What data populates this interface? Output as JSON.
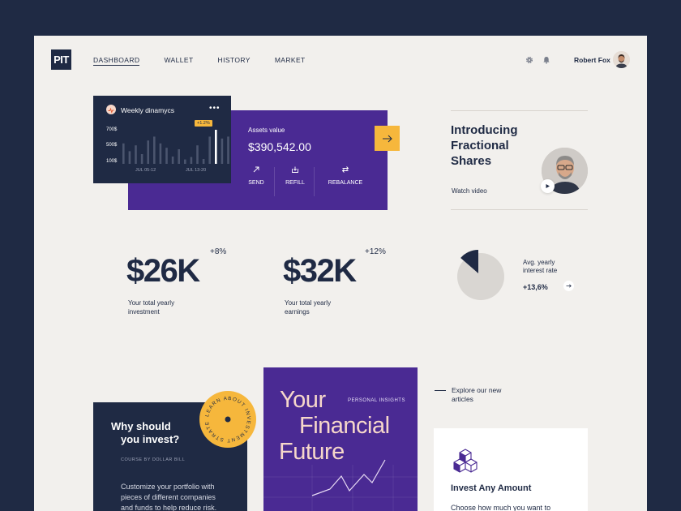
{
  "brand": {
    "logo": "PIT"
  },
  "nav": {
    "items": [
      "DASHBOARD",
      "WALLET",
      "HISTORY",
      "MARKET"
    ],
    "active": "DASHBOARD"
  },
  "user": {
    "name": "Robert Fox"
  },
  "weekly": {
    "title": "Weekly dinamycs",
    "menu": "•••",
    "y_labels": [
      "700$",
      "500$",
      "100$"
    ],
    "x_labels": [
      "JUL 05-12",
      "JUL 13-20"
    ],
    "highlight_tag": "+1.2%"
  },
  "chart_data": {
    "type": "bar",
    "title": "Weekly dinamycs",
    "ylabel": "",
    "xlabel": "",
    "y_ticks": [
      "700$",
      "500$",
      "100$"
    ],
    "x_ticks": [
      "JUL 05-12",
      "JUL 13-20"
    ],
    "values": [
      420,
      260,
      380,
      200,
      480,
      560,
      420,
      330,
      150,
      300,
      90,
      140,
      380,
      100,
      560,
      700,
      520,
      560
    ],
    "highlight_index": 15,
    "highlight_label": "+1.2%",
    "ylim": [
      0,
      800
    ]
  },
  "assets": {
    "label": "Assets value",
    "value": "$390,542.00",
    "actions": [
      "SEND",
      "REFILL",
      "REBALANCE"
    ]
  },
  "promo": {
    "title_lines": [
      "Introducing",
      "Fractional",
      "Shares"
    ],
    "watch": "Watch video"
  },
  "stats": [
    {
      "value": "$26K",
      "change": "+8%",
      "caption_lines": [
        "Your total yearly",
        "investment"
      ]
    },
    {
      "value": "$32K",
      "change": "+12%",
      "caption_lines": [
        "Your total yearly",
        "earnings"
      ]
    }
  ],
  "pie": {
    "caption_lines": [
      "Avg. yearly",
      "interest rate"
    ],
    "value": "+13,6%",
    "share": 0.136
  },
  "why": {
    "title_lines": [
      "Why should",
      "you invest?"
    ],
    "course": "COURSE BY DOLLAR BILL",
    "body": "Customize your portfolio with pieces of different companies and funds to help reduce risk.",
    "badge_text": "LEARN ABOUT INVESTMENT STRATEGIES"
  },
  "financial": {
    "lines": [
      "Your",
      "Financial",
      "Future"
    ],
    "tag": "PERSONAL INSIGHTS"
  },
  "explore": {
    "lines": [
      "Explore our new",
      "articles"
    ]
  },
  "invest_card": {
    "title": "Invest Any Amount",
    "desc": "Choose how much you want to"
  },
  "colors": {
    "navy": "#1f2a44",
    "purple": "#4a2a93",
    "yellow": "#f6b73c",
    "bg": "#f2f0ed"
  }
}
